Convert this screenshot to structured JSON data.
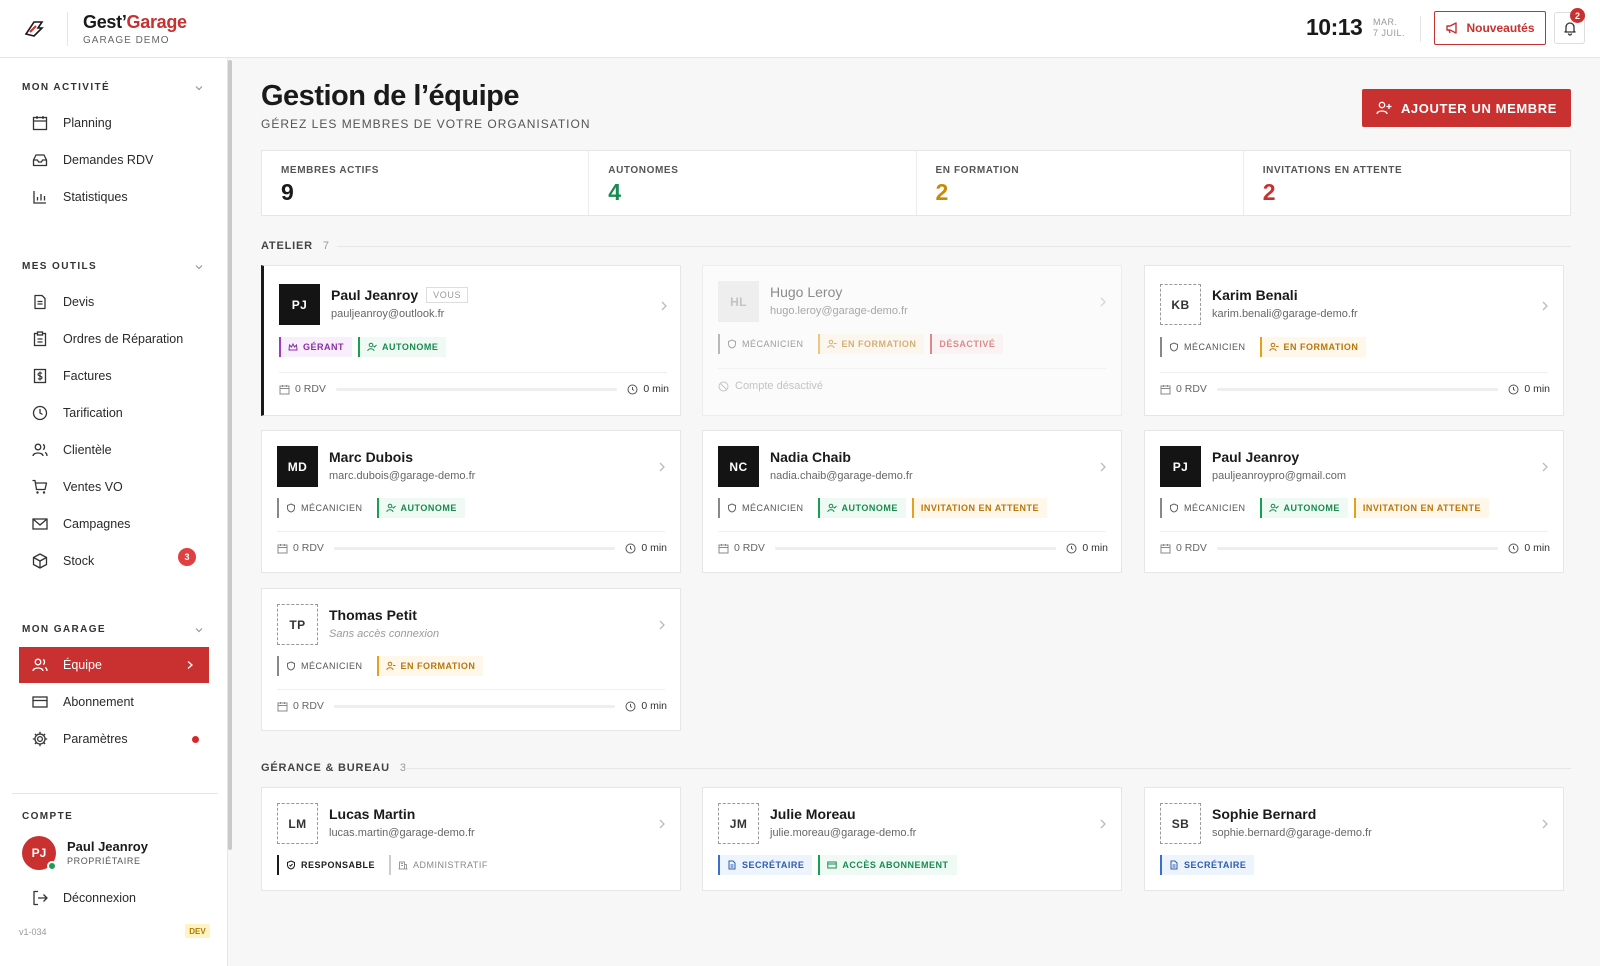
{
  "header": {
    "brand_main": "Gest’",
    "brand_accent": "Garage",
    "brand_sub": "GARAGE DEMO",
    "time": "10:13",
    "date_line1": "MAR.",
    "date_line2": "7 JUIL.",
    "news_label": "Nouveautés",
    "notif_count": "2",
    "accent_color": "#c8312f"
  },
  "sidebar": {
    "sections": [
      {
        "title": "MON ACTIVITÉ",
        "items": [
          {
            "label": "Planning",
            "icon": "calendar-icon"
          },
          {
            "label": "Demandes RDV",
            "icon": "inbox-icon"
          },
          {
            "label": "Statistiques",
            "icon": "bar-chart-icon"
          }
        ]
      },
      {
        "title": "MES OUTILS",
        "items": [
          {
            "label": "Devis",
            "icon": "document-icon"
          },
          {
            "label": "Ordres de Réparation",
            "icon": "clipboard-icon"
          },
          {
            "label": "Factures",
            "icon": "invoice-icon"
          },
          {
            "label": "Tarification",
            "icon": "clock-icon"
          },
          {
            "label": "Clientèle",
            "icon": "users-icon"
          },
          {
            "label": "Ventes VO",
            "icon": "cart-icon"
          },
          {
            "label": "Campagnes",
            "icon": "mail-icon"
          },
          {
            "label": "Stock",
            "icon": "box-icon",
            "badge": "3"
          }
        ]
      },
      {
        "title": "MON GARAGE",
        "items": [
          {
            "label": "Équipe",
            "icon": "team-icon",
            "active": true
          },
          {
            "label": "Abonnement",
            "icon": "credit-card-icon"
          },
          {
            "label": "Paramètres",
            "icon": "gear-icon"
          }
        ]
      }
    ],
    "account": {
      "title": "COMPTE",
      "initials": "PJ",
      "name": "Paul Jeanroy",
      "role": "PROPRIÉTAIRE",
      "logout": "Déconnexion",
      "version": "v1-034",
      "env": "DEV"
    }
  },
  "main": {
    "title": "Gestion de l’équipe",
    "subtitle": "GÉREZ LES MEMBRES DE VOTRE ORGANISATION",
    "add_button": "AJOUTER UN MEMBRE",
    "stats": [
      {
        "label": "MEMBRES ACTIFS",
        "value": "9",
        "color": "#1a1a1a"
      },
      {
        "label": "AUTONOMES",
        "value": "4",
        "color": "#1a8a50"
      },
      {
        "label": "EN FORMATION",
        "value": "2",
        "color": "#c98a0c"
      },
      {
        "label": "INVITATIONS EN ATTENTE",
        "value": "2",
        "color": "#c8312f"
      }
    ],
    "groups": [
      {
        "title": "ATELIER",
        "count": "7"
      },
      {
        "title": "GÉRANCE & BUREAU",
        "count": "3"
      }
    ],
    "members": [
      {
        "initials": "PJ",
        "name": "Paul Jeanroy",
        "you": "VOUS",
        "email": "pauljeanroy@outlook.fr",
        "tags": [
          "GÉRANT",
          "AUTONOME"
        ],
        "rdv": "0 RDV",
        "time": "0 min"
      },
      {
        "initials": "HL",
        "name": "Hugo Leroy",
        "email": "hugo.leroy@garage-demo.fr",
        "tags": [
          "MÉCANICIEN",
          "EN FORMATION",
          "DÉSACTIVÉ"
        ],
        "note": "Compte désactivé"
      },
      {
        "initials": "KB",
        "name": "Karim Benali",
        "email": "karim.benali@garage-demo.fr",
        "tags": [
          "MÉCANICIEN",
          "EN FORMATION"
        ],
        "rdv": "0 RDV",
        "time": "0 min"
      },
      {
        "initials": "MD",
        "name": "Marc Dubois",
        "email": "marc.dubois@garage-demo.fr",
        "tags": [
          "MÉCANICIEN",
          "AUTONOME"
        ],
        "rdv": "0 RDV",
        "time": "0 min"
      },
      {
        "initials": "NC",
        "name": "Nadia Chaib",
        "email": "nadia.chaib@garage-demo.fr",
        "tags": [
          "MÉCANICIEN",
          "AUTONOME",
          "INVITATION EN ATTENTE"
        ],
        "rdv": "0 RDV",
        "time": "0 min"
      },
      {
        "initials": "PJ",
        "name": "Paul Jeanroy",
        "email": "pauljeanroypro@gmail.com",
        "tags": [
          "MÉCANICIEN",
          "AUTONOME",
          "INVITATION EN ATTENTE"
        ],
        "rdv": "0 RDV",
        "time": "0 min"
      },
      {
        "initials": "TP",
        "name": "Thomas Petit",
        "email": "Sans accès connexion",
        "tags": [
          "MÉCANICIEN",
          "EN FORMATION"
        ],
        "rdv": "0 RDV",
        "time": "0 min"
      },
      {
        "initials": "LM",
        "name": "Lucas Martin",
        "email": "lucas.martin@garage-demo.fr",
        "tags": [
          "RESPONSABLE",
          "ADMINISTRATIF"
        ]
      },
      {
        "initials": "JM",
        "name": "Julie Moreau",
        "email": "julie.moreau@garage-demo.fr",
        "tags": [
          "SECRÉTAIRE",
          "ACCÈS ABONNEMENT"
        ]
      },
      {
        "initials": "SB",
        "name": "Sophie Bernard",
        "email": "sophie.bernard@garage-demo.fr",
        "tags": [
          "SECRÉTAIRE"
        ]
      }
    ]
  }
}
